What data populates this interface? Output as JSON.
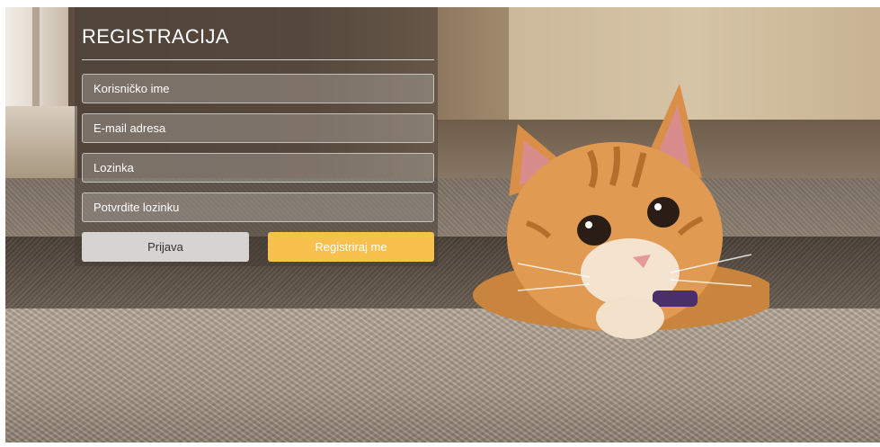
{
  "form": {
    "title": "REGISTRACIJA",
    "fields": {
      "username_placeholder": "Korisničko ime",
      "email_placeholder": "E-mail adresa",
      "password_placeholder": "Lozinka",
      "confirm_password_placeholder": "Potvrdite lozinku"
    },
    "buttons": {
      "login_label": "Prijava",
      "register_label": "Registriraj me"
    }
  },
  "colors": {
    "panel_overlay": "#463c34",
    "login_button_bg": "#d6d3d0",
    "register_button_bg": "#f8c14e",
    "text_primary": "#ffffff"
  }
}
